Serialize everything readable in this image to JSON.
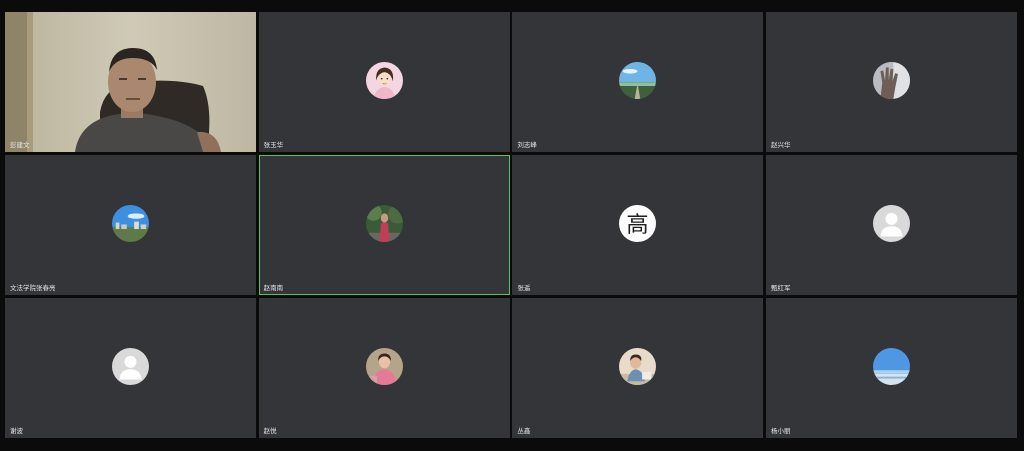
{
  "meeting": {
    "participants": [
      {
        "name": "彭建文",
        "view": "video",
        "avatar": "person-video-icon"
      },
      {
        "name": "张玉华",
        "view": "avatar",
        "avatar": "woman-portrait-icon"
      },
      {
        "name": "刘志峰",
        "view": "avatar",
        "avatar": "sky-landscape-icon"
      },
      {
        "name": "赵兴华",
        "view": "avatar",
        "avatar": "hand-photo-icon"
      },
      {
        "name": "文法学院张春亮",
        "view": "avatar",
        "avatar": "city-sky-icon"
      },
      {
        "name": "赵南南",
        "view": "avatar",
        "avatar": "outdoor-person-icon",
        "speaking": true
      },
      {
        "name": "张遥",
        "view": "avatar",
        "avatar": "glyph-gao-icon",
        "glyph": "高"
      },
      {
        "name": "甄红军",
        "view": "avatar",
        "avatar": "default-user-icon"
      },
      {
        "name": "谢波",
        "view": "avatar",
        "avatar": "default-user-icon"
      },
      {
        "name": "赵悦",
        "view": "avatar",
        "avatar": "pink-portrait-icon"
      },
      {
        "name": "丛鑫",
        "view": "avatar",
        "avatar": "child-photo-icon"
      },
      {
        "name": "杨小丽",
        "view": "avatar",
        "avatar": "beach-horizon-icon"
      }
    ]
  },
  "colors": {
    "tile_background": "#333538",
    "speaking_border": "#5bbf6a",
    "page_background": "#0b0b0b"
  }
}
